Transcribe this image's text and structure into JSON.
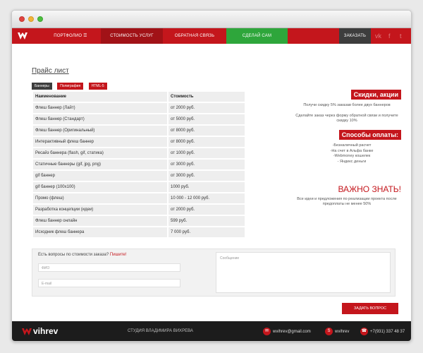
{
  "nav": {
    "portfolio": "ПОРТФОЛИО",
    "services": "СТОИМОСТЬ УСЛУГ",
    "feedback": "ОБРАТНАЯ СВЯЗЬ",
    "diy": "СДЕЛАЙ САМ",
    "order": "ЗАКАЗАТЬ",
    "social": [
      "vk-icon",
      "facebook-icon",
      "twitter-icon"
    ]
  },
  "page": {
    "title": "Прайс лист",
    "tags": [
      "Баннеры",
      "Полиграфия",
      "HTML-5"
    ]
  },
  "table": {
    "headers": [
      "Наименование",
      "Стоимость"
    ],
    "rows": [
      [
        "Флеш баннер (Лайт)",
        "от 2000 руб."
      ],
      [
        "Флеш баннер (Стандарт)",
        "от 5000 руб."
      ],
      [
        "Флеш баннер (Оригинальный)",
        "от 8000 руб."
      ],
      [
        "Интерактивный флеш баннер",
        "от 8000 руб."
      ],
      [
        "Ресайз баннера (flash, gif, статика)",
        "от 1000 руб."
      ],
      [
        "Статичные баннеры (gif, jpg, png)",
        "от 3000 руб."
      ],
      [
        "gif баннер",
        "от 3000 руб."
      ],
      [
        "gif баннер (100x100)",
        "1000 руб."
      ],
      [
        "Промо (флеш)",
        "10 000 - 12 000 руб."
      ],
      [
        "Разработка концепции (идеи)",
        "от 2000 руб."
      ],
      [
        "Флеш баннер онлайн",
        "599 руб."
      ],
      [
        "Исходник флеш баннера",
        "7 000 руб."
      ]
    ]
  },
  "sidebar": {
    "discounts_heading": "Скидки, акции",
    "discount1": "Получи скидку 5% заказав более двух баннеров",
    "discount2": "Сделайте заказ через форму обратной связи и получите скидку 10%",
    "payment_heading": "Способы оплаты:",
    "payment": [
      "-Безналичный расчет",
      "-На счет в Альфа банке",
      "-Webmoney кошелек",
      "- Яндекс деньги"
    ],
    "important_heading": "ВАЖНО ЗНАТЬ!",
    "important_text": "Все идеи и предложения по реализации проекта после предоплаты не менее 50%"
  },
  "form": {
    "question": "Есть вопросы по стоимости заказа?",
    "question_link": "Пишите!",
    "name_placeholder": "ФИО",
    "email_placeholder": "E-mail",
    "message_placeholder": "Сообщение",
    "submit": "ЗАДАТЬ ВОПРОС"
  },
  "footer": {
    "brand": "vihrev",
    "studio": "СТУДИЯ ВЛАДИМИРА ВИХРЕВА",
    "email": "wvihrev@gmail.com",
    "skype": "wvihrev",
    "phone": "+7(931) 337 48 37"
  },
  "colors": {
    "accent": "#c4161c",
    "green": "#2ea63b",
    "dark": "#1c1c1c"
  }
}
